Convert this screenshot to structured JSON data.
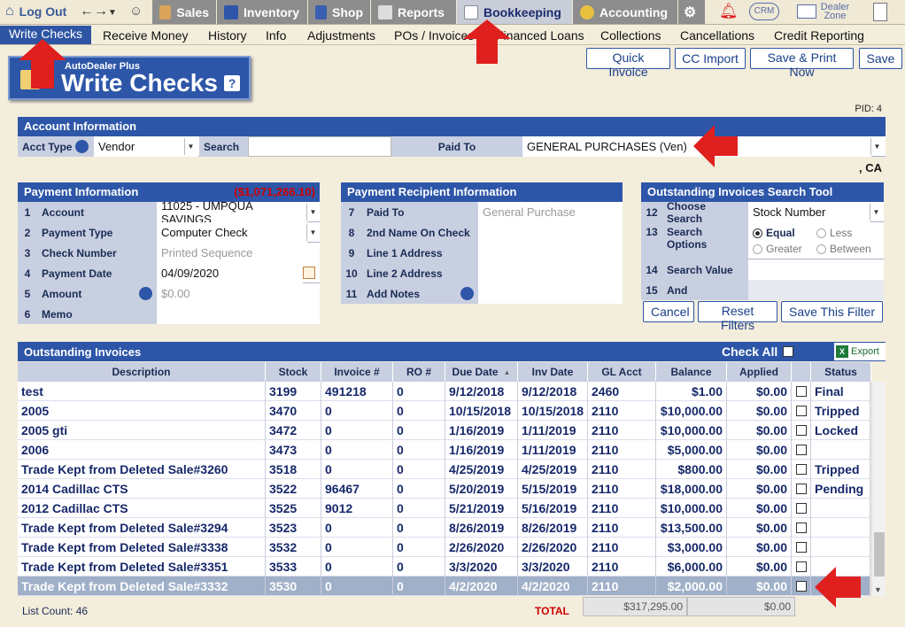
{
  "topbar": {
    "logout": "Log Out",
    "modules": [
      "Sales",
      "Inventory",
      "Shop",
      "Reports",
      "Bookkeeping",
      "Accounting"
    ],
    "right": {
      "crm": "CRM",
      "dealer_zone": "Dealer Zone"
    }
  },
  "subnav": [
    "Write Checks",
    "Receive Money",
    "History",
    "Info",
    "Adjustments",
    "POs / Invoices",
    "Financed Loans",
    "Collections",
    "Cancellations",
    "Credit Reporting"
  ],
  "header_buttons": [
    "Quick Invoice",
    "CC Import",
    "Save & Print Now",
    "Save"
  ],
  "logo": {
    "small": "AutoDealer Plus",
    "big": "Write Checks",
    "help": "?"
  },
  "pid": "PID: 4",
  "account": {
    "title": "Account Information",
    "acct_type_label": "Acct Type",
    "acct_type": "Vendor",
    "search_label": "Search",
    "paid_to_label": "Paid To",
    "paid_to": "GENERAL PURCHASES (Ven)",
    "location": ", CA"
  },
  "payment": {
    "title": "Payment Information",
    "total": "($1,071,266.10)",
    "rows": [
      {
        "n": "1",
        "label": "Account",
        "value": "11025 - UMPQUA SAVINGS"
      },
      {
        "n": "2",
        "label": "Payment Type",
        "value": "Computer Check"
      },
      {
        "n": "3",
        "label": "Check Number",
        "value": "Printed Sequence"
      },
      {
        "n": "4",
        "label": "Payment Date",
        "value": "04/09/2020"
      },
      {
        "n": "5",
        "label": "Amount",
        "value": "$0.00"
      },
      {
        "n": "6",
        "label": "Memo",
        "value": ""
      }
    ]
  },
  "recipient": {
    "title": "Payment Recipient Information",
    "rows": [
      {
        "n": "7",
        "label": "Paid To",
        "value": "General Purchase"
      },
      {
        "n": "8",
        "label": "2nd Name On Check",
        "value": ""
      },
      {
        "n": "9",
        "label": "Line 1 Address",
        "value": ""
      },
      {
        "n": "10",
        "label": "Line 2 Address",
        "value": ""
      },
      {
        "n": "11",
        "label": "Add Notes",
        "value": ""
      }
    ]
  },
  "search_tool": {
    "title": "Outstanding Invoices Search Tool",
    "rows": [
      {
        "n": "12",
        "label": "Choose Search",
        "value": "Stock Number"
      },
      {
        "n": "13",
        "label": "Search Options",
        "value": ""
      },
      {
        "n": "14",
        "label": "Search Value",
        "value": ""
      },
      {
        "n": "15",
        "label": "And",
        "value": ""
      }
    ],
    "options": [
      "Equal",
      "Less",
      "Greater",
      "Between"
    ],
    "buttons": [
      "Cancel",
      "Reset Filters",
      "Save This Filter"
    ]
  },
  "invoices": {
    "title": "Outstanding Invoices",
    "check_all": "Check All",
    "export": "Export",
    "columns": [
      "Description",
      "Stock",
      "Invoice #",
      "RO #",
      "Due Date",
      "Inv Date",
      "GL Acct",
      "Balance",
      "Applied",
      "",
      "Status"
    ],
    "rows": [
      [
        "test",
        "3199",
        "491218",
        "0",
        "9/12/2018",
        "9/12/2018",
        "2460",
        "$1.00",
        "$0.00",
        "Final"
      ],
      [
        "2005",
        "3470",
        "0",
        "0",
        "10/15/2018",
        "10/15/2018",
        "2110",
        "$10,000.00",
        "$0.00",
        "Tripped"
      ],
      [
        "2005 gti",
        "3472",
        "0",
        "0",
        "1/16/2019",
        "1/11/2019",
        "2110",
        "$10,000.00",
        "$0.00",
        "Locked"
      ],
      [
        "2006",
        "3473",
        "0",
        "0",
        "1/16/2019",
        "1/11/2019",
        "2110",
        "$5,000.00",
        "$0.00",
        ""
      ],
      [
        "Trade Kept from Deleted Sale#3260",
        "3518",
        "0",
        "0",
        "4/25/2019",
        "4/25/2019",
        "2110",
        "$800.00",
        "$0.00",
        "Tripped"
      ],
      [
        "2014 Cadillac CTS",
        "3522",
        "96467",
        "0",
        "5/20/2019",
        "5/15/2019",
        "2110",
        "$18,000.00",
        "$0.00",
        "Pending"
      ],
      [
        "2012 Cadillac CTS",
        "3525",
        "9012",
        "0",
        "5/21/2019",
        "5/16/2019",
        "2110",
        "$10,000.00",
        "$0.00",
        ""
      ],
      [
        "Trade Kept from Deleted Sale#3294",
        "3523",
        "0",
        "0",
        "8/26/2019",
        "8/26/2019",
        "2110",
        "$13,500.00",
        "$0.00",
        ""
      ],
      [
        "Trade Kept from Deleted Sale#3338",
        "3532",
        "0",
        "0",
        "2/26/2020",
        "2/26/2020",
        "2110",
        "$3,000.00",
        "$0.00",
        ""
      ],
      [
        "Trade Kept from Deleted Sale#3351",
        "3533",
        "0",
        "0",
        "3/3/2020",
        "3/3/2020",
        "2110",
        "$6,000.00",
        "$0.00",
        ""
      ],
      [
        "Trade Kept from Deleted Sale#3332",
        "3530",
        "0",
        "0",
        "4/2/2020",
        "4/2/2020",
        "2110",
        "$2,000.00",
        "$0.00",
        ""
      ]
    ],
    "list_count_label": "List Count:",
    "list_count": "46",
    "total_label": "TOTAL",
    "total_balance": "$317,295.00",
    "total_applied": "$0.00"
  },
  "colors": {
    "brand": "#2d56a8",
    "header_gray": "#8d8d8d",
    "arrow": "#e0201f",
    "negative": "#d00000"
  }
}
